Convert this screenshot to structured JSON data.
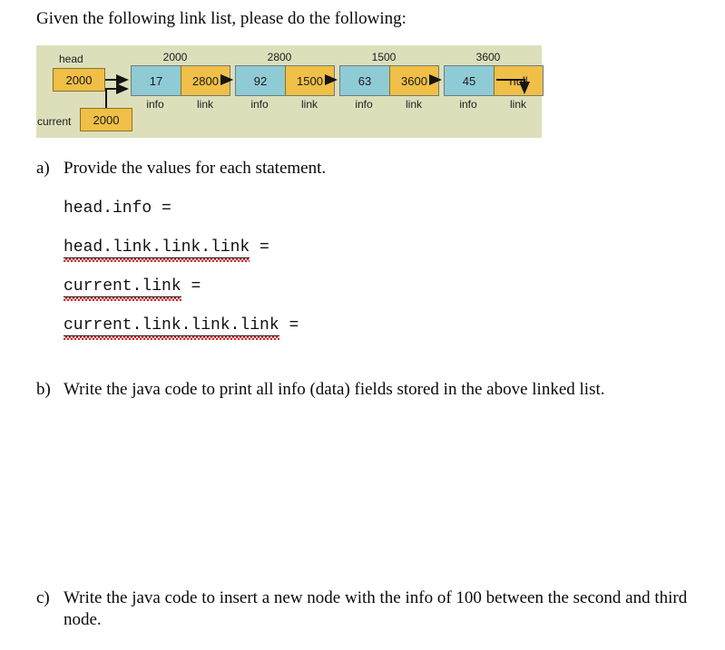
{
  "document": {
    "intro": "Given the following link list, please do the following:"
  },
  "diagram": {
    "head_label": "head",
    "head_value": "2000",
    "current_label": "current",
    "current_value": "2000",
    "info_field_label": "info",
    "link_field_label": "link",
    "colors": {
      "background": "#dddfbb",
      "info_cell": "#8fcbd5",
      "link_cell": "#efbf47",
      "node_border": "#6f7a7c",
      "pointer_border": "#8a7321",
      "arrow": "#141414"
    },
    "nodes": [
      {
        "address": "2000",
        "info": "17",
        "link": "2800"
      },
      {
        "address": "2800",
        "info": "92",
        "link": "1500"
      },
      {
        "address": "1500",
        "info": "63",
        "link": "3600"
      },
      {
        "address": "3600",
        "info": "45",
        "link": "null"
      }
    ]
  },
  "questions": [
    {
      "marker": "a)",
      "text": "Provide the values for each statement.",
      "code_lines": [
        {
          "expr": "head.info",
          "equals": "=",
          "misspelled": false
        },
        {
          "expr": "head.link.link.link",
          "equals": "=",
          "misspelled": true
        },
        {
          "expr": "current.link",
          "equals": "=",
          "misspelled": true
        },
        {
          "expr": "current.link.link.link",
          "equals": "=",
          "misspelled": true
        }
      ]
    },
    {
      "marker": "b)",
      "text": "Write the java code to print all info (data) fields stored in the above linked list.",
      "code_lines": []
    },
    {
      "marker": "c)",
      "text": "Write the java code to insert a new node with the info of 100 between the second and third node.",
      "code_lines": []
    }
  ]
}
